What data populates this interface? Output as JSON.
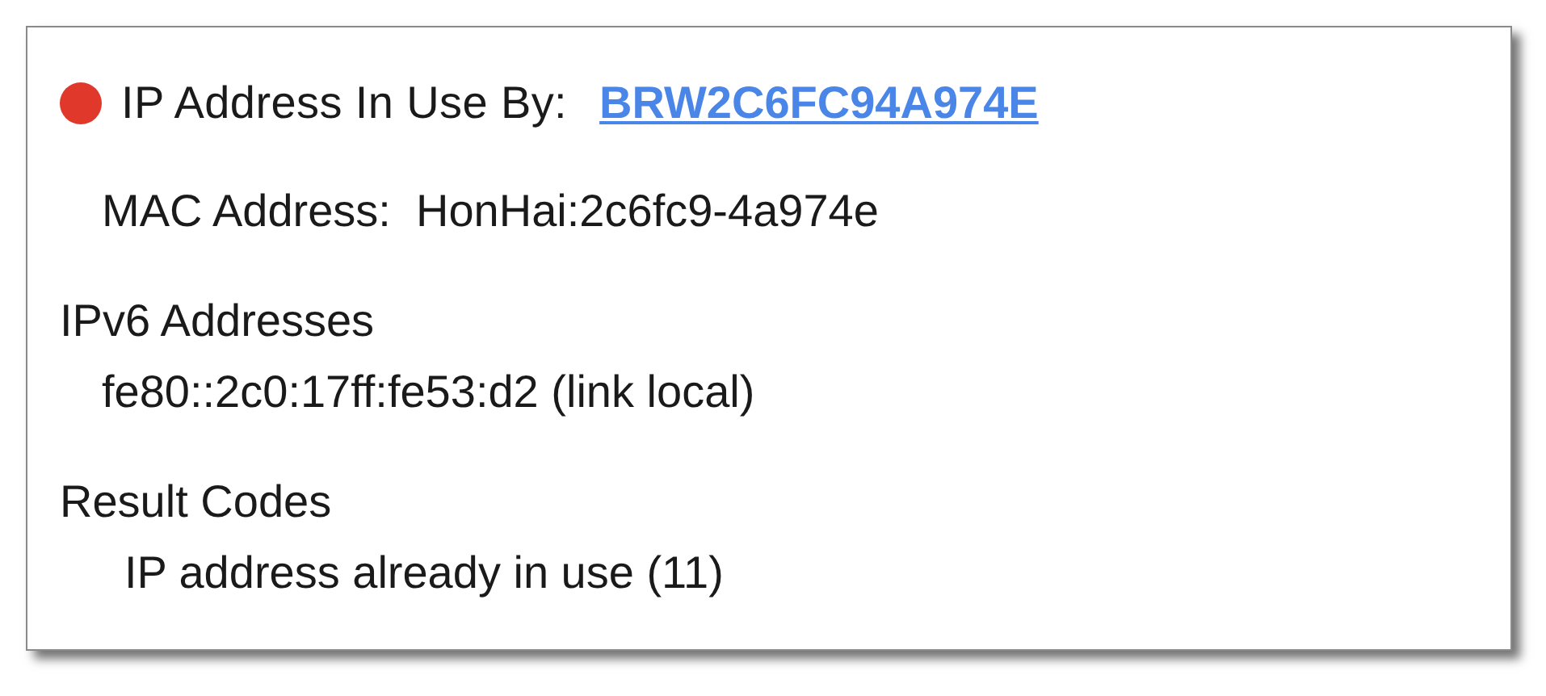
{
  "status": {
    "color": "#e0382b"
  },
  "title": "IP Address In Use By:",
  "device_link": "BRW2C6FC94A974E",
  "mac": {
    "label": "MAC Address:",
    "value": "HonHai:2c6fc9-4a974e"
  },
  "sections": [
    {
      "heading": "IPv6 Addresses",
      "items": [
        "fe80::2c0:17ff:fe53:d2 (link local)"
      ]
    },
    {
      "heading": "Result Codes",
      "items": [
        "IP address already in use (11)"
      ]
    }
  ]
}
